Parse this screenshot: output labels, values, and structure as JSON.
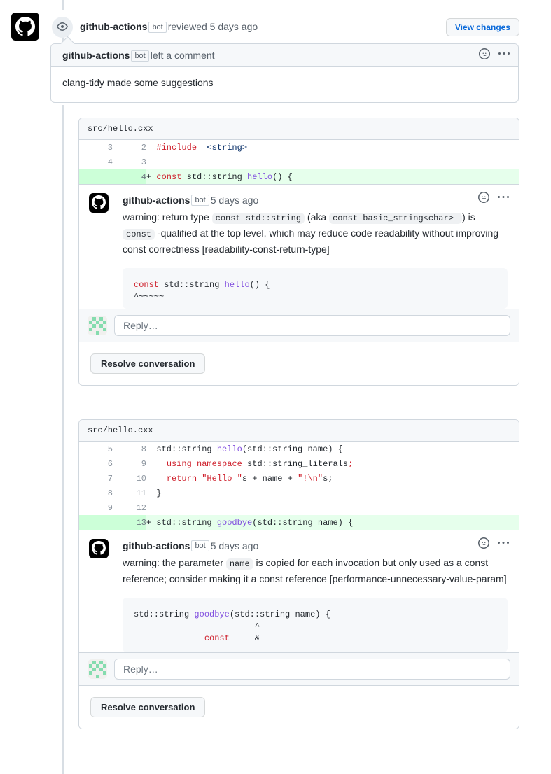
{
  "review_header": {
    "actor": "github-actions",
    "bot_tag": "bot",
    "action_text": "reviewed 5 days ago",
    "view_changes_label": "View changes",
    "eye_icon": "eye-icon",
    "avatar_icon": "github-logo-icon"
  },
  "review_comment": {
    "actor": "github-actions",
    "bot_tag": "bot",
    "action_text": "left a comment",
    "body": "clang-tidy made some suggestions",
    "reaction_icon": "smiley-icon",
    "menu_icon": "kebab-menu-icon"
  },
  "threads": [
    {
      "file": "src/hello.cxx",
      "diff": [
        {
          "old": "3",
          "new": "2",
          "type": "context",
          "marker": "",
          "segments": [
            {
              "t": "  ",
              "c": "pl"
            },
            {
              "t": "#include",
              "c": "k"
            },
            {
              "t": "  ",
              "c": "pl"
            },
            {
              "t": "<string>",
              "c": "s"
            }
          ]
        },
        {
          "old": "4",
          "new": "3",
          "type": "context",
          "marker": "",
          "segments": []
        },
        {
          "old": "",
          "new": "4",
          "type": "added",
          "marker": "+ ",
          "segments": [
            {
              "t": "const",
              "c": "k"
            },
            {
              "t": " std::string ",
              "c": "pl"
            },
            {
              "t": "hello",
              "c": "fn"
            },
            {
              "t": "() {",
              "c": "pl"
            }
          ]
        }
      ],
      "comment": {
        "actor": "github-actions",
        "bot_tag": "bot",
        "timestamp": "5 days ago",
        "reaction_icon": "smiley-icon",
        "menu_icon": "kebab-menu-icon",
        "body_parts": [
          {
            "kind": "text",
            "text": "warning: return type "
          },
          {
            "kind": "code",
            "text": "const std::string"
          },
          {
            "kind": "text",
            "text": " (aka "
          },
          {
            "kind": "code",
            "text": "const basic_string<char> "
          },
          {
            "kind": "text",
            "text": ") is "
          },
          {
            "kind": "code",
            "text": "const"
          },
          {
            "kind": "text",
            "text": " -qualified at the top level, which may reduce code readability without improving const correctness [readability-const-return-type]"
          }
        ],
        "code_lines": [
          [
            {
              "t": "const",
              "c": "k"
            },
            {
              "t": " std::string ",
              "c": "pl"
            },
            {
              "t": "hello",
              "c": "fn"
            },
            {
              "t": "() {",
              "c": "pl"
            }
          ],
          [
            {
              "t": "^~~~~~",
              "c": "pl"
            }
          ]
        ]
      },
      "reply_placeholder": "Reply…",
      "resolve_label": "Resolve conversation"
    },
    {
      "file": "src/hello.cxx",
      "diff": [
        {
          "old": "5",
          "new": "8",
          "type": "context",
          "marker": "",
          "segments": [
            {
              "t": "  std::string ",
              "c": "pl"
            },
            {
              "t": "hello",
              "c": "fn"
            },
            {
              "t": "(std::string name) {",
              "c": "pl"
            }
          ]
        },
        {
          "old": "6",
          "new": "9",
          "type": "context",
          "marker": "",
          "segments": [
            {
              "t": "    ",
              "c": "pl"
            },
            {
              "t": "using",
              "c": "k"
            },
            {
              "t": " ",
              "c": "pl"
            },
            {
              "t": "namespace",
              "c": "k"
            },
            {
              "t": " std::string_literals",
              "c": "pl"
            },
            {
              "t": ";",
              "c": "k"
            }
          ]
        },
        {
          "old": "7",
          "new": "10",
          "type": "context",
          "marker": "",
          "segments": [
            {
              "t": "    ",
              "c": "pl"
            },
            {
              "t": "return",
              "c": "k"
            },
            {
              "t": " ",
              "c": "pl"
            },
            {
              "t": "\"Hello \"",
              "c": "k"
            },
            {
              "t": "s + name + ",
              "c": "pl"
            },
            {
              "t": "\"!\\n\"",
              "c": "k"
            },
            {
              "t": "s;",
              "c": "pl"
            }
          ]
        },
        {
          "old": "8",
          "new": "11",
          "type": "context",
          "marker": "",
          "segments": [
            {
              "t": "  }",
              "c": "pl"
            }
          ]
        },
        {
          "old": "9",
          "new": "12",
          "type": "context",
          "marker": "",
          "segments": []
        },
        {
          "old": "",
          "new": "13",
          "type": "added",
          "marker": "+ ",
          "segments": [
            {
              "t": "std::string ",
              "c": "pl"
            },
            {
              "t": "goodbye",
              "c": "fn"
            },
            {
              "t": "(std::string name) {",
              "c": "pl"
            }
          ]
        }
      ],
      "comment": {
        "actor": "github-actions",
        "bot_tag": "bot",
        "timestamp": "5 days ago",
        "reaction_icon": "smiley-icon",
        "menu_icon": "kebab-menu-icon",
        "body_parts": [
          {
            "kind": "text",
            "text": "warning: the parameter "
          },
          {
            "kind": "code",
            "text": "name"
          },
          {
            "kind": "text",
            "text": " is copied for each invocation but only used as a const reference; consider making it a const reference [performance-unnecessary-value-param]"
          }
        ],
        "code_lines": [
          [
            {
              "t": "std::string ",
              "c": "pl"
            },
            {
              "t": "goodbye",
              "c": "fn"
            },
            {
              "t": "(std::string name) {",
              "c": "pl"
            }
          ],
          [
            {
              "t": "                        ^",
              "c": "pl"
            }
          ],
          [
            {
              "t": "              ",
              "c": "pl"
            },
            {
              "t": "const",
              "c": "k"
            },
            {
              "t": "     &",
              "c": "pl"
            }
          ]
        ]
      },
      "reply_placeholder": "Reply…",
      "resolve_label": "Resolve conversation"
    }
  ],
  "colors": {
    "border": "#d0d7de",
    "added_bg": "#e6ffec",
    "added_gutter": "#ccffd8",
    "link": "#0969da",
    "muted": "#57606a",
    "header_bg": "#f6f8fa"
  }
}
